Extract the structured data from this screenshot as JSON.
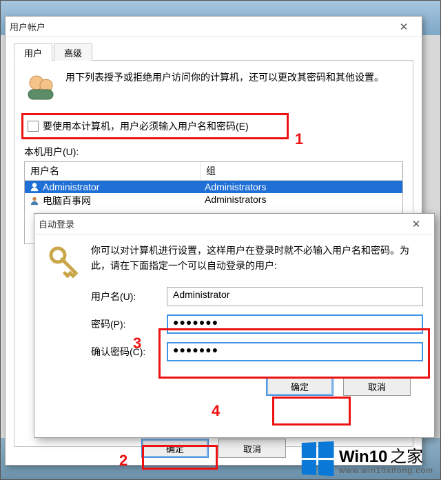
{
  "dlg1": {
    "title": "用户帐户",
    "tabs": [
      "用户",
      "高级"
    ],
    "intro": "用下列表授予或拒绝用户访问你的计算机，还可以更改其密码和其他设置。",
    "checkbox_label": "要使用本计算机，用户必须输入用户名和密码(E)",
    "checkbox_checked": false,
    "list_label": "本机用户(U):",
    "columns": [
      "用户名",
      "组"
    ],
    "rows": [
      {
        "name": "Administrator",
        "group": "Administrators",
        "selected": true
      },
      {
        "name": "电脑百事网",
        "group": "Administrators",
        "selected": false
      }
    ],
    "ok": "确定",
    "cancel": "取消"
  },
  "dlg2": {
    "title": "自动登录",
    "intro": "你可以对计算机进行设置，这样用户在登录时就不必输入用户名和密码。为此，请在下面指定一个可以自动登录的用户:",
    "username_label": "用户名(U):",
    "username_value": "Administrator",
    "password_label": "密码(P):",
    "password_value": "●●●●●●●",
    "confirm_label": "确认密码(C):",
    "confirm_value": "●●●●●●●",
    "ok": "确定",
    "cancel": "取消"
  },
  "annotations": {
    "1": "1",
    "2": "2",
    "3": "3",
    "4": "4"
  },
  "logo": {
    "brand": "Win10",
    "sub": "之家",
    "url": "www.win10xitong.com"
  }
}
